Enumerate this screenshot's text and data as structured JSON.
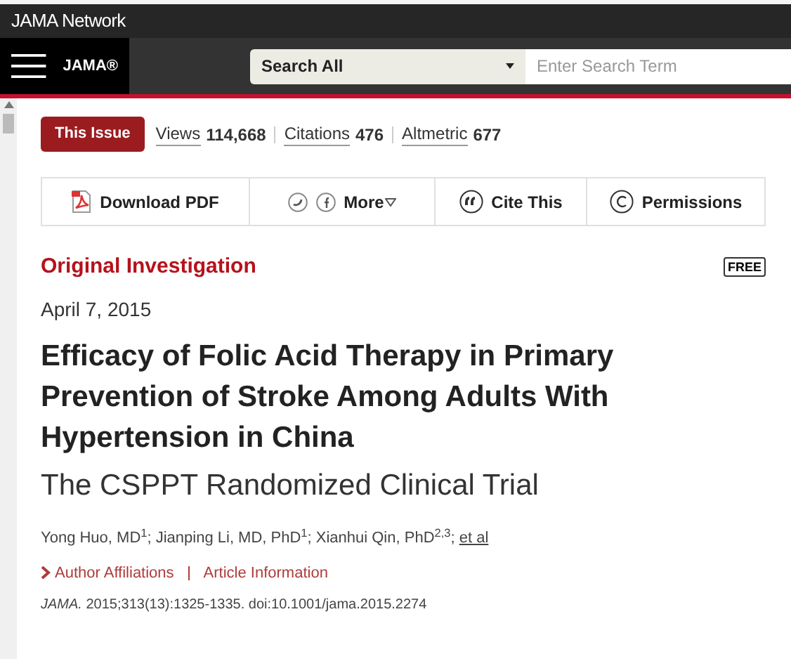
{
  "network_bar": {
    "brand": "JAMA Network"
  },
  "nav": {
    "brand": "JAMA®",
    "search_scope": "Search All",
    "search": {
      "placeholder": "Enter Search Term"
    }
  },
  "metrics": {
    "issue_button": "This Issue",
    "items": [
      {
        "label": "Views",
        "value": "114,668"
      },
      {
        "label": "Citations",
        "value": "476"
      },
      {
        "label": "Altmetric",
        "value": "677"
      }
    ]
  },
  "toolbar": [
    {
      "kind": "pdf",
      "label": "Download PDF"
    },
    {
      "kind": "share",
      "label": "More"
    },
    {
      "kind": "cite",
      "label": "Cite This"
    },
    {
      "kind": "permissions",
      "label": "Permissions"
    }
  ],
  "article": {
    "type": "Original Investigation",
    "badge": "FREE",
    "date": "April 7, 2015",
    "title": "Efficacy of Folic Acid Therapy in Primary Prevention of Stroke Among Adults With Hypertension in China",
    "subtitle": "The CSPPT Randomized Clinical Trial",
    "authors": "Yong Huo, MD$^{1}$; Jianping Li, MD, PhD$^{1}$; Xianhui Qin, PhD$^{2,3}$;",
    "et_al": "et al",
    "links": [
      "Author Affiliations",
      "Article Information"
    ],
    "citation": "*JAMA.* 2015;313(13):1325-1335. doi:10.1001/jama.2015.2274"
  }
}
